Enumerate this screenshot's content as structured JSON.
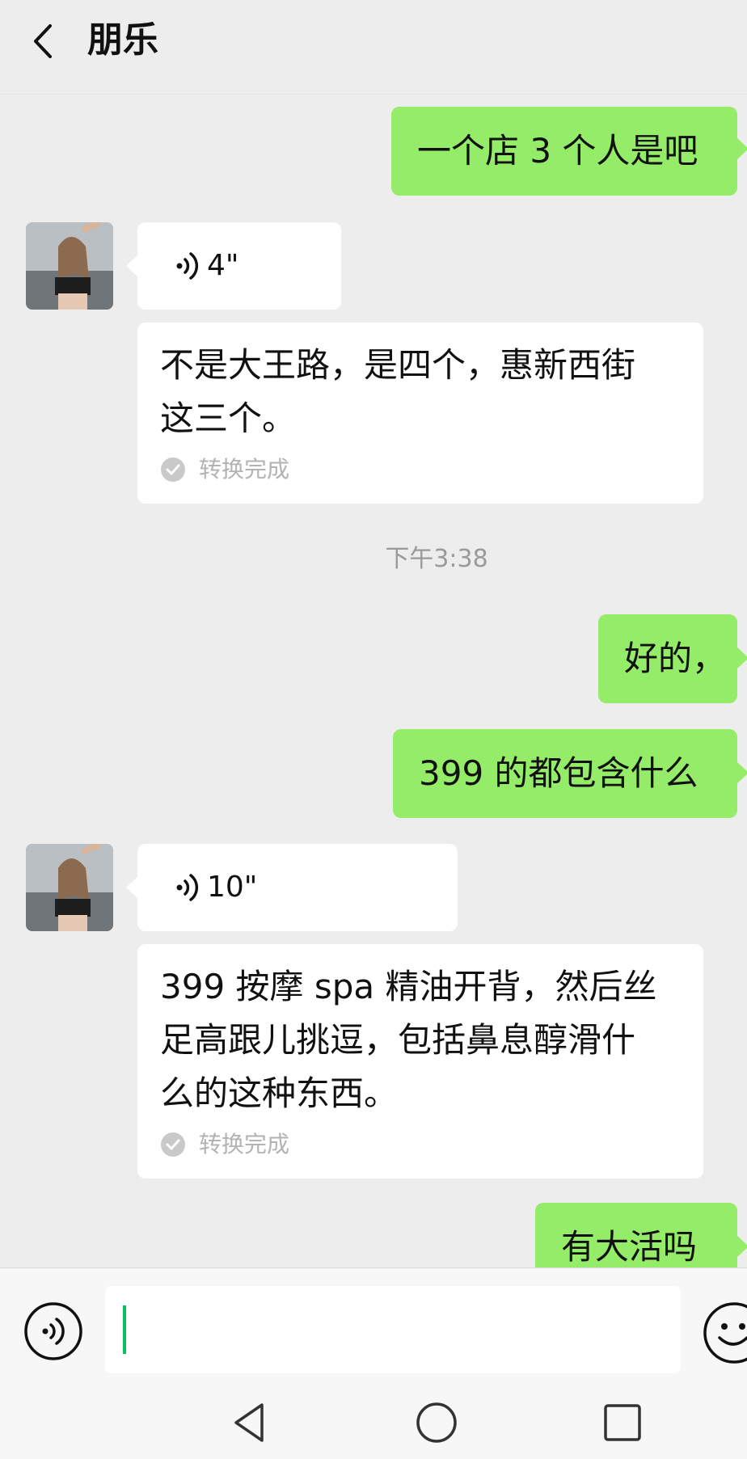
{
  "header": {
    "title": "朋乐"
  },
  "messages": {
    "m1": {
      "text": "一个店 3 个人是吧"
    },
    "voice1": {
      "duration": "4\"",
      "line1": "不是大王路，是四个，惠新西街",
      "line2": "这三个。",
      "status": "转换完成"
    },
    "timestamp": "下午3:38",
    "m2": {
      "text": "好的，"
    },
    "m3": {
      "text": "399 的都包含什么"
    },
    "voice2": {
      "duration": "10\"",
      "line1": "399 按摩 spa 精油开背，然后丝",
      "line2": "足高跟儿挑逗，包括鼻息醇滑什",
      "line3": "么的这种东西。",
      "status": "转换完成"
    },
    "m4": {
      "text": "有大活吗"
    }
  },
  "colors": {
    "sent_bubble": "#95ec69",
    "received_bubble": "#ffffff",
    "background": "#ededed",
    "caret": "#07c160"
  },
  "icons": {
    "back": "chevron-left-icon",
    "voice": "voice-wave-icon",
    "check": "check-circle-icon",
    "voice_toggle": "voice-mode-icon",
    "emoji": "emoji-icon",
    "nav_back": "triangle-back-icon",
    "nav_home": "circle-home-icon",
    "nav_recent": "square-recents-icon"
  }
}
